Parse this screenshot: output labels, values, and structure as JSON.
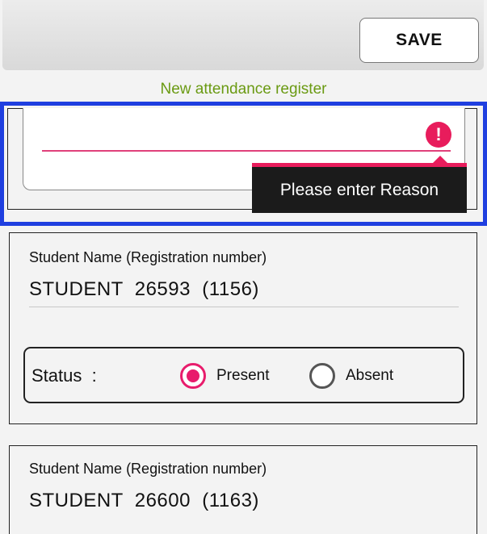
{
  "toolbar": {
    "save_label": "SAVE"
  },
  "header": {
    "subtitle": "New attendance register"
  },
  "reason": {
    "value": "",
    "error_icon": "exclamation-icon",
    "error_message": "Please enter Reason"
  },
  "students": [
    {
      "field_label": "Student Name (Registration number)",
      "name_value": "STUDENT  26593  (1156)",
      "status_label": "Status  :",
      "options": [
        "Present",
        "Absent"
      ],
      "selected": "Present"
    },
    {
      "field_label": "Student Name (Registration number)",
      "name_value": "STUDENT  26600  (1163)"
    }
  ],
  "colors": {
    "accent": "#e81c6c",
    "subtitle": "#6a9a12",
    "focus_outline": "#1f3fe0"
  }
}
